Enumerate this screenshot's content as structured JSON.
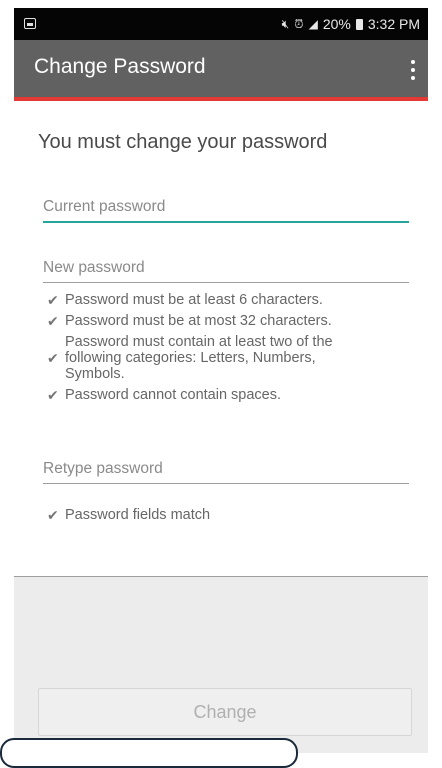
{
  "status_bar": {
    "battery_text": "20%",
    "time": "3:32 PM",
    "icons": [
      "image-icon",
      "mute-icon",
      "alarm-icon",
      "signal-icon",
      "battery-icon"
    ]
  },
  "app_bar": {
    "title": "Change Password",
    "menu_icon": "more-vert-icon",
    "accent_color": "#e53935",
    "background_color": "#616161"
  },
  "form": {
    "heading": "You must change your password",
    "current_password": {
      "placeholder": "Current password",
      "value": ""
    },
    "new_password": {
      "placeholder": "New password",
      "value": ""
    },
    "rules": [
      "Password must be at least 6 characters.",
      "Password must be at most 32 characters.",
      "Password must contain at least two of the\nfollowing categories: Letters, Numbers,\nSymbols.",
      "Password cannot contain spaces."
    ],
    "retype_password": {
      "placeholder": "Retype password",
      "value": ""
    },
    "match_rule": "Password fields match",
    "check_symbol": "✔",
    "focus_color": "#26a69a"
  },
  "actions": {
    "change_label": "Change"
  }
}
